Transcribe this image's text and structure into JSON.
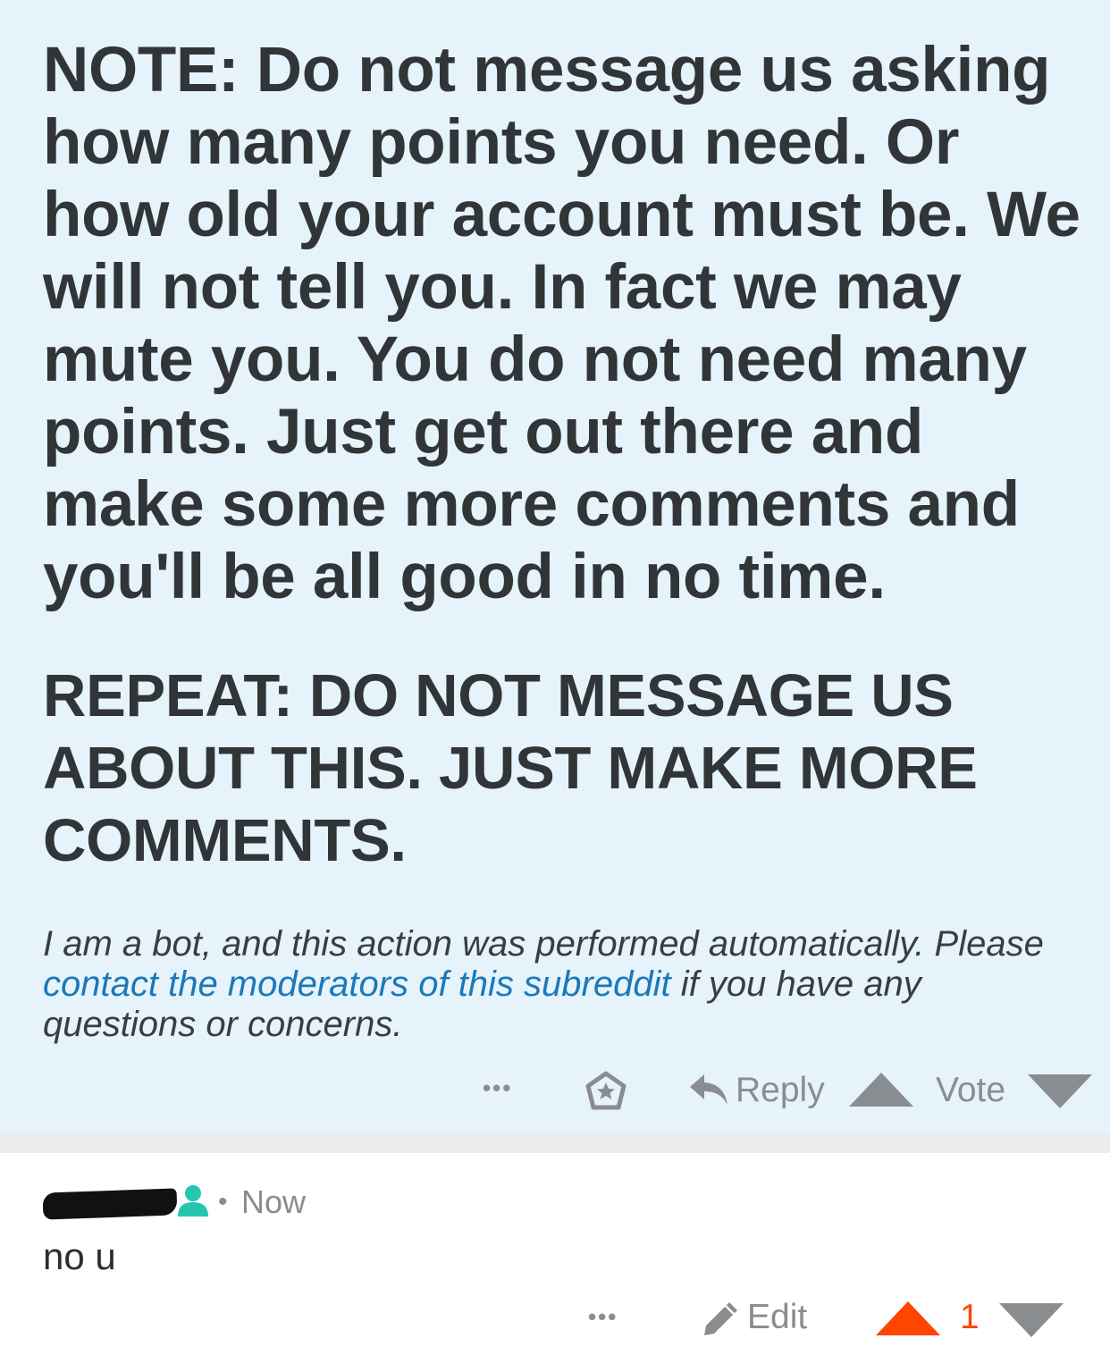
{
  "bot_comment": {
    "note": "NOTE: Do not message us asking how many points you need. Or how old your account must be. We will not tell you. In fact we may mute you. You do not need many points. Just get out there and make some more comments and you'll be all good in no time.",
    "repeat": "REPEAT: DO NOT MESSAGE US ABOUT THIS. JUST MAKE MORE COMMENTS.",
    "footer_pre": "I am a bot, and this action was performed automatically. Please ",
    "footer_link": "contact the moderators of this subreddit",
    "footer_post": " if you have any questions or concerns.",
    "actions": {
      "more": "•••",
      "reply_label": "Reply",
      "vote_label": "Vote"
    }
  },
  "user_comment": {
    "separator": "•",
    "time": "Now",
    "body": "no u",
    "actions": {
      "more": "•••",
      "edit_label": "Edit",
      "score": "1"
    }
  },
  "colors": {
    "bot_bg": "#e6f3fb",
    "link": "#1a79b9",
    "upvoted": "#ff4500",
    "op_icon": "#24c6b0",
    "divider": "#ebecee"
  }
}
